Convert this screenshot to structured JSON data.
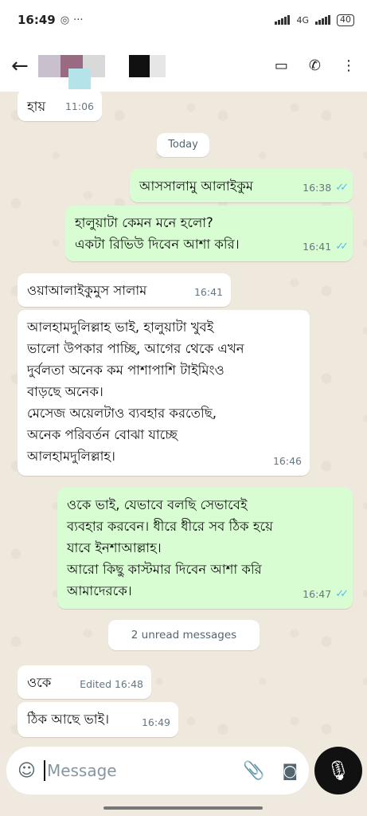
{
  "status_bar": {
    "time": "16:49",
    "network": "4G",
    "battery": "40"
  },
  "header": {
    "back_icon": "arrow-left-icon"
  },
  "date_pill": "Today",
  "unread_pill": "2 unread messages",
  "messages": [
    {
      "direction": "in",
      "text": "হায়",
      "time": "11:06"
    },
    {
      "direction": "out",
      "text": "আসসালামু আলাইকুম",
      "time": "16:38",
      "ticks": "read"
    },
    {
      "direction": "out",
      "text": "হালুয়াটা কেমন মনে হলো?\nএকটা রিভিউ দিবেন আশা করি।",
      "time": "16:41",
      "ticks": "read"
    },
    {
      "direction": "in",
      "text": "ওয়াআলাইকুমুস সালাম",
      "time": "16:41"
    },
    {
      "direction": "in",
      "text": "আলহামদুলিল্লাহ ভাই,  হালুয়াটা খুবই\nভালো উপকার পাচ্ছি,  আগের থেকে এখন\nদুর্বলতা অনেক কম পাশাপাশি টাইমিংও\nবাড়ছে অনেক।\nমেসেজ অয়েলটাও ব্যবহার করতেছি,\nঅনেক পরিবর্তন বোঝা যাচ্ছে\nআলহামদুলিল্লাহ।",
      "time": "16:46"
    },
    {
      "direction": "out",
      "text": "ওকে ভাই,  যেভাবে বলছি সেভাবেই\nব্যবহার করবেন।  ধীরে ধীরে সব ঠিক হয়ে\nযাবে ইনশাআল্লাহ।\nআরো কিছু কাস্টমার দিবেন আশা করি\nআমাদেরকে।",
      "time": "16:47",
      "ticks": "read"
    },
    {
      "direction": "in",
      "text": "ওকে",
      "time": "Edited 16:48"
    },
    {
      "direction": "in",
      "text": "ঠিক আছে ভাই।",
      "time": "16:49"
    }
  ],
  "composer": {
    "placeholder": "Message"
  },
  "colors": {
    "outgoing_bubble": "#d8fdd2",
    "incoming_bubble": "#ffffff",
    "read_ticks": "#53bdeb",
    "mic_button": "#111111"
  }
}
